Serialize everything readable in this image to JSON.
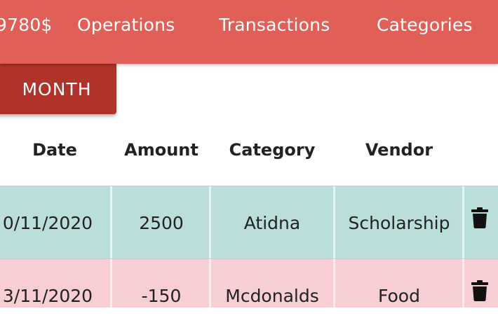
{
  "navbar": {
    "balance": "9780$",
    "items": [
      "Operations",
      "Transactions",
      "Categories"
    ]
  },
  "month_button": {
    "label": "MONTH"
  },
  "table": {
    "headers": [
      "Date",
      "Amount",
      "Category",
      "Vendor"
    ],
    "rows": [
      {
        "date": "0/11/2020",
        "amount": "2500",
        "category": "Atidna",
        "vendor": "Scholarship",
        "color": "#badfda"
      },
      {
        "date": "3/11/2020",
        "amount": "-150",
        "category": "Mcdonalds",
        "vendor": "Food",
        "color": "#f6ced3"
      }
    ]
  },
  "colors": {
    "navbar": "#e05f56",
    "button": "#b03329",
    "income_row": "#badfda",
    "expense_row": "#f6ced3"
  },
  "icons": {
    "delete": "trash-icon"
  }
}
